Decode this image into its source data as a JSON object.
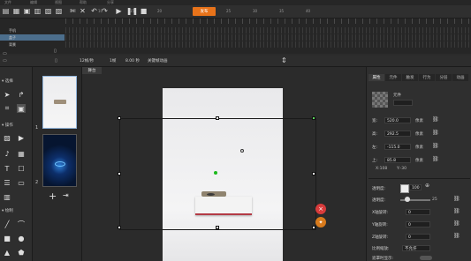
{
  "menubar": {
    "items": [
      "文件",
      "编辑",
      "视图",
      "帮助",
      "分享"
    ]
  },
  "toolbar": {
    "publish_label": "发布",
    "ruler": [
      "5",
      "10",
      "15",
      "20",
      "25",
      "30",
      "35",
      "40"
    ]
  },
  "timeline": {
    "layers": [
      {
        "name": "手机"
      },
      {
        "name": "盖子"
      },
      {
        "name": "背景"
      }
    ]
  },
  "status": {
    "fps": "12帧/秒",
    "frame": "1帧",
    "time": "8.00 秒",
    "keyframe": "关键帧动画"
  },
  "leftpanel": {
    "sections": {
      "select": "选择",
      "operate": "操作",
      "draw": "绘制"
    },
    "text_tool": "T"
  },
  "pages": {
    "page1": "1",
    "page2": "2"
  },
  "stage": {
    "tab": "舞台"
  },
  "rightpanel": {
    "tabs": [
      "属性",
      "元件",
      "触发",
      "行为",
      "分层",
      "动画"
    ],
    "element_name": "元件",
    "fields": {
      "width": {
        "label": "宽:",
        "value": "520.0",
        "unit": "像素"
      },
      "height": {
        "label": "高:",
        "value": "292.5",
        "unit": "像素"
      },
      "left": {
        "label": "左:",
        "value": "-115.0",
        "unit": "像素"
      },
      "top": {
        "label": "上:",
        "value": "85.8",
        "unit": "像素"
      }
    },
    "coords": {
      "x": "X:108",
      "y": "Y:-30"
    },
    "opacity": {
      "label": "透明度:",
      "value": "25"
    },
    "color_value": "100",
    "x_rot": {
      "label": "X轴旋转:",
      "value": "0"
    },
    "y_rot": {
      "label": "Y轴旋转:",
      "value": "0"
    },
    "z_rot": {
      "label": "Z轴旋转:",
      "value": "0"
    },
    "ratio": {
      "label": "比例缩放:",
      "value": "不允许"
    },
    "footer": "遮罩时显示:"
  }
}
